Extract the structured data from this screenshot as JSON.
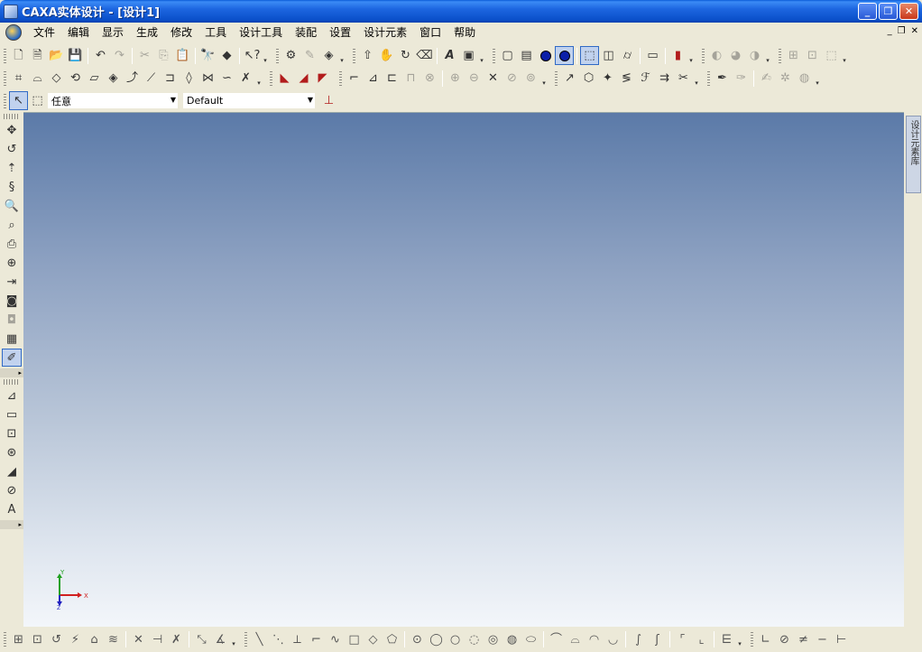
{
  "window": {
    "title": "CAXA实体设计 - [设计1]",
    "buttons": {
      "minimize": "_",
      "restore": "❐",
      "close": "✕"
    }
  },
  "menu": {
    "items": [
      "文件",
      "编辑",
      "显示",
      "生成",
      "修改",
      "工具",
      "设计工具",
      "装配",
      "设置",
      "设计元素",
      "窗口",
      "帮助"
    ],
    "mdi_buttons": {
      "minimize": "_",
      "restore": "❐",
      "close": "✕"
    }
  },
  "selector_row": {
    "filter_value": "任意",
    "style_value": "Default"
  },
  "right_panel": {
    "tab_label": "设计元素库"
  },
  "axis": {
    "x_label": "X",
    "y_label": "Y",
    "z_label": "Z"
  },
  "colors": {
    "titlebar": "#0a4fc9",
    "viewport_top": "#5b7aa8",
    "viewport_bottom": "#f3f6fa",
    "axis_x": "#d02020",
    "axis_y": "#20a020",
    "axis_z": "#2020c0"
  }
}
